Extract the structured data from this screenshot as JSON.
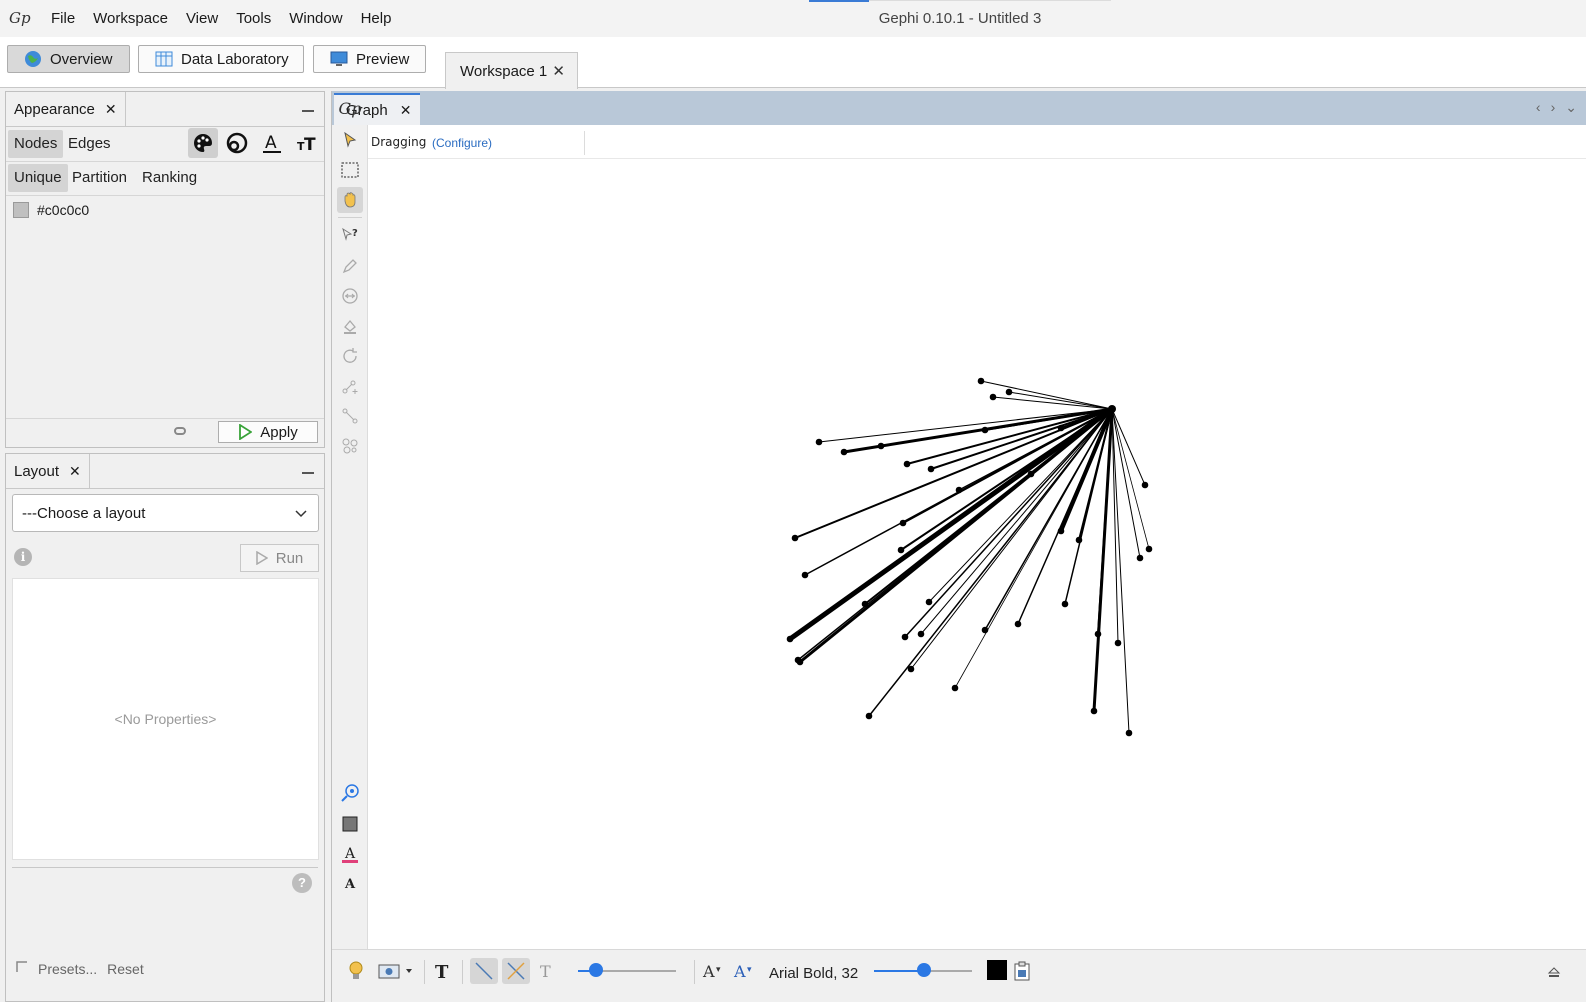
{
  "app": {
    "window_title": "Gephi 0.10.1 - Untitled 3",
    "logo_text": "Gp",
    "menu": [
      "File",
      "Workspace",
      "View",
      "Tools",
      "Window",
      "Help"
    ]
  },
  "toolbar": {
    "overview_label": "Overview",
    "data_lab_label": "Data Laboratory",
    "preview_label": "Preview",
    "workspace_tab": "Workspace 1"
  },
  "appearance": {
    "title": "Appearance",
    "targets": [
      "Nodes",
      "Edges"
    ],
    "modes": [
      "Unique",
      "Partition",
      "Ranking"
    ],
    "color_value": "#c0c0c0",
    "apply_label": "Apply"
  },
  "layout": {
    "title": "Layout",
    "select_value": "---Choose a layout",
    "run_label": "Run",
    "no_props": "<No Properties>",
    "presets_label": "Presets...",
    "reset_label": "Reset"
  },
  "graph": {
    "tab_label": "Graph",
    "tool_mode": "Dragging",
    "configure_label": "(Configure)",
    "font_label": "Arial Bold, 32",
    "hub": [
      1111,
      409
    ],
    "nodes": [
      {
        "p": [
          980,
          381
        ],
        "w": 1
      },
      {
        "p": [
          1008,
          392
        ],
        "w": 1
      },
      {
        "p": [
          992,
          397
        ],
        "w": 1
      },
      {
        "p": [
          818,
          442
        ],
        "w": 1
      },
      {
        "p": [
          843,
          452
        ],
        "w": 3
      },
      {
        "p": [
          880,
          446
        ],
        "w": 2
      },
      {
        "p": [
          906,
          464
        ],
        "w": 2
      },
      {
        "p": [
          930,
          469
        ],
        "w": 2
      },
      {
        "p": [
          958,
          490
        ],
        "w": 1.5
      },
      {
        "p": [
          794,
          538
        ],
        "w": 2
      },
      {
        "p": [
          902,
          523
        ],
        "w": 2
      },
      {
        "p": [
          900,
          550
        ],
        "w": 2
      },
      {
        "p": [
          804,
          575
        ],
        "w": 1.5
      },
      {
        "p": [
          789,
          639
        ],
        "w": 5
      },
      {
        "p": [
          864,
          604
        ],
        "w": 2
      },
      {
        "p": [
          799,
          662
        ],
        "w": 3
      },
      {
        "p": [
          797,
          660
        ],
        "w": 1.5
      },
      {
        "p": [
          928,
          602
        ],
        "w": 1
      },
      {
        "p": [
          904,
          637
        ],
        "w": 1.5
      },
      {
        "p": [
          920,
          634
        ],
        "w": 1
      },
      {
        "p": [
          910,
          669
        ],
        "w": 1
      },
      {
        "p": [
          868,
          716
        ],
        "w": 1.5
      },
      {
        "p": [
          954,
          688
        ],
        "w": 0.8
      },
      {
        "p": [
          984,
          630
        ],
        "w": 1.5
      },
      {
        "p": [
          1017,
          624
        ],
        "w": 1.5
      },
      {
        "p": [
          1030,
          474
        ],
        "w": 1.5
      },
      {
        "p": [
          1060,
          531
        ],
        "w": 4
      },
      {
        "p": [
          1078,
          540
        ],
        "w": 2
      },
      {
        "p": [
          1064,
          604
        ],
        "w": 1.5
      },
      {
        "p": [
          1097,
          634
        ],
        "w": 2
      },
      {
        "p": [
          1093,
          711
        ],
        "w": 3
      },
      {
        "p": [
          1117,
          643
        ],
        "w": 1
      },
      {
        "p": [
          1128,
          733
        ],
        "w": 1
      },
      {
        "p": [
          1144,
          485
        ],
        "w": 1
      },
      {
        "p": [
          1139,
          558
        ],
        "w": 1
      },
      {
        "p": [
          1148,
          549
        ],
        "w": 0.8
      },
      {
        "p": [
          1060,
          428
        ],
        "w": 1.5
      },
      {
        "p": [
          984,
          430
        ],
        "w": 2
      }
    ]
  }
}
